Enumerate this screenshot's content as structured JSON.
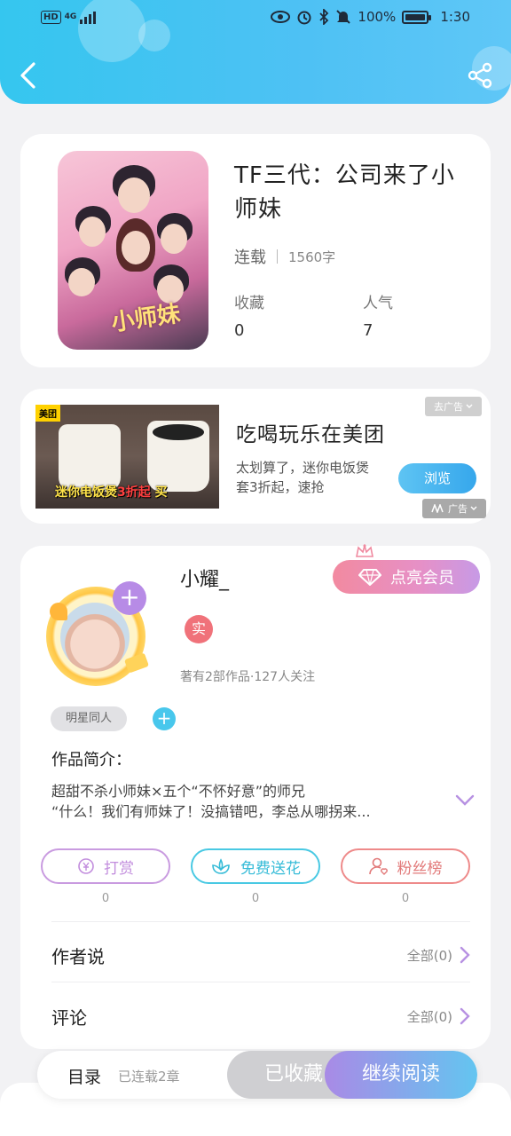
{
  "status_bar": {
    "hd": "HD",
    "network": "4G",
    "battery": "100%",
    "time": "1:30"
  },
  "header": {
    "back_icon": "chevron-left-icon",
    "share_icon": "share-icon"
  },
  "book": {
    "cover_text": "小师妹",
    "title": "TF三代：公司来了小师妹",
    "status": "连载",
    "words": "1560字",
    "favorites_label": "收藏",
    "favorites_value": "0",
    "popularity_label": "人气",
    "popularity_value": "7"
  },
  "ad": {
    "logo": "美团",
    "banner_text_a": "迷你电饭煲",
    "banner_text_b": "3折起",
    "banner_text_c": "买",
    "title": "吃喝玩乐在美团",
    "description": "太划算了，迷你电饭煲套3折起，速抢",
    "button": "浏览",
    "close_label": "去广告",
    "ad_label": "广告"
  },
  "author": {
    "name": "小耀_",
    "vip_button": "点亮会员",
    "real_badge": "实",
    "meta": "著有2部作品·127人关注",
    "tag": "明星同人",
    "tag_add": "+",
    "avatar_plus": "+",
    "intro_title": "作品简介：",
    "intro_line1": "超甜不杀小师妹×五个“不怀好意”的师兄",
    "intro_line2": "“什么！我们有师妹了！没搞错吧，李总从哪拐来..."
  },
  "actions": [
    {
      "label": "打赏",
      "count": "0",
      "icon": "yen-coin-icon",
      "color": "#c99be0"
    },
    {
      "label": "免费送花",
      "count": "0",
      "icon": "flower-icon",
      "color": "#49c9e3"
    },
    {
      "label": "粉丝榜",
      "count": "0",
      "icon": "fan-user-icon",
      "color": "#ee8a8a"
    }
  ],
  "rows": {
    "author_says": "作者说",
    "author_says_right": "全部(0)",
    "comments": "评论",
    "comments_right": "全部(0)"
  },
  "bottom_bar": {
    "toc": "目录",
    "toc_sub": "已连载2章",
    "favorited": "已收藏",
    "continue": "继续阅读"
  }
}
